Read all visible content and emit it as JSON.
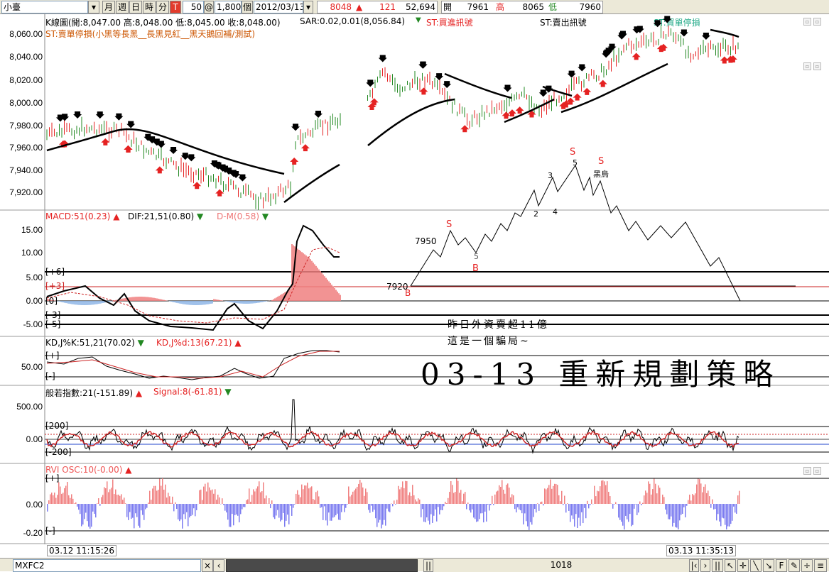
{
  "toolbar": {
    "symbol": "小臺",
    "period_buttons": [
      "月",
      "週",
      "日",
      "時",
      "分",
      "T"
    ],
    "tick_count": "50",
    "at": "@",
    "tick_size": "1,800",
    "unit": "個",
    "date": "2012/03/13",
    "last": "8048",
    "change": "121",
    "volume": "52,694",
    "open_label": "開",
    "open": "7961",
    "high_label": "高",
    "high": "8065",
    "low_label": "低",
    "low": "7960"
  },
  "price_panel": {
    "header": "K線圖(開:8,047.00 高:8,048.00 低:8,045.00 收:8,048.00)",
    "sar": "SAR:0.02,0.01(8,056.84)",
    "st_buy": "ST:買進訊號",
    "st_sell": "ST:賣出訊號",
    "st_buy_stop": "ST:買單停損",
    "st_sell_stop": "ST:賣單停損(小黑等長黑__長黑見紅__黑天鵝回補/測試)",
    "yticks": [
      "8,060.00",
      "8,040.00",
      "8,020.00",
      "8,000.00",
      "7,980.00",
      "7,960.00",
      "7,940.00",
      "7,920.00"
    ]
  },
  "macd_panel": {
    "macd": "MACD:51(0.23)",
    "dif": "DIF:21,51(0.80)",
    "dm": "D-M(0.58)",
    "yticks": [
      "15.00",
      "10.00",
      "5.00",
      "0.00",
      "-5.00"
    ],
    "levels": [
      "[+6]",
      "[+3]",
      "[0]",
      "[-3]",
      "[-5]"
    ]
  },
  "kd_panel": {
    "k": "KD,J%K:51,21(70.02)",
    "d": "KD,J%d:13(67.21)",
    "ytick": "50.00",
    "levels": [
      "[+]",
      "[-]"
    ]
  },
  "osc_panel": {
    "label": "般若指數:21(-151.89)",
    "signal": "Signal:8(-61.81)",
    "yticks": [
      "500.00",
      "0.00"
    ],
    "levels": [
      "[200]",
      "[-200]"
    ]
  },
  "rvi_panel": {
    "label": "RVI OSC:10(-0.00)",
    "yticks": [
      "0.00",
      "-0.20"
    ],
    "levels": [
      "[+]",
      "[-]"
    ]
  },
  "time_axis": {
    "start": "03.12 11:15:26",
    "end": "03.13 11:35:13"
  },
  "sketch": {
    "labels": [
      "7950",
      "7920",
      "S",
      "B",
      "5",
      "B",
      "2",
      "3",
      "4",
      "5",
      "S",
      "S",
      "黑烏"
    ],
    "note1": "昨日外資賣超11億",
    "note2": "這是一個騙局~",
    "title": "03-13 重新規劃策略"
  },
  "statusbar": {
    "symbol": "MXFC2",
    "count": "1018"
  },
  "colors": {
    "up": "#e52222",
    "down": "#228822",
    "signal_buy": "#e52222",
    "signal_sell": "#000000",
    "rvi_pos": "#f08080",
    "rvi_neg": "#7b7bf0"
  }
}
